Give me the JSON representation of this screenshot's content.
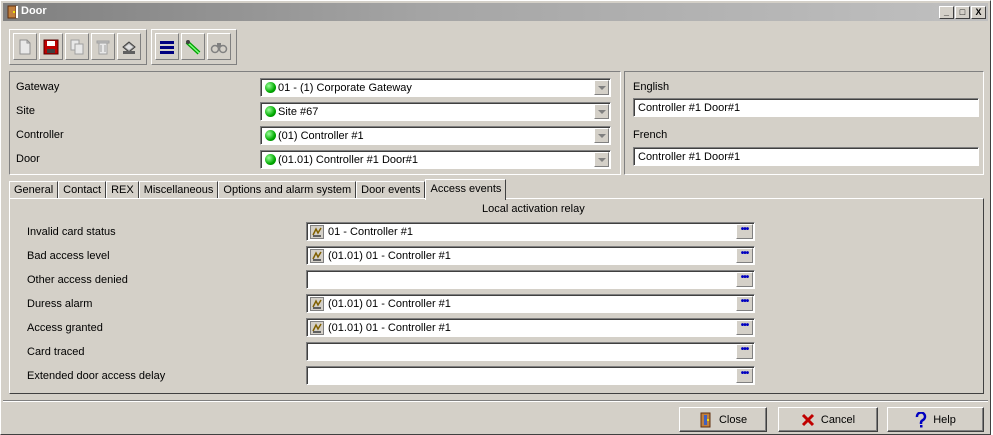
{
  "window": {
    "title": "Door"
  },
  "titlebar_buttons": {
    "minimize": "_",
    "maximize": "□",
    "close": "X"
  },
  "toolbar": {
    "icons": [
      "new-icon",
      "save-icon",
      "copy-icon",
      "delete-icon",
      "print-icon",
      "list-icon",
      "link-icon",
      "find-icon"
    ]
  },
  "door_form": {
    "gateway_label": "Gateway",
    "gateway_value": "01 - (1)  Corporate Gateway",
    "site_label": "Site",
    "site_value": "Site #67",
    "controller_label": "Controller",
    "controller_value": "(01) Controller #1",
    "door_label": "Door",
    "door_value": "(01.01) Controller #1 Door#1"
  },
  "names": {
    "english_label": "English",
    "english_value": "Controller #1 Door#1",
    "french_label": "French",
    "french_value": "Controller #1 Door#1"
  },
  "tabs": [
    {
      "label": "General"
    },
    {
      "label": "Contact"
    },
    {
      "label": "REX"
    },
    {
      "label": "Miscellaneous"
    },
    {
      "label": "Options and alarm system"
    },
    {
      "label": "Door events"
    },
    {
      "label": "Access events",
      "active": true
    }
  ],
  "access_events": {
    "column_header": "Local activation relay",
    "rows": [
      {
        "label": "Invalid card status",
        "value": "01 - Controller #1",
        "has_icon": true
      },
      {
        "label": "Bad access level",
        "value": "(01.01) 01 - Controller #1",
        "has_icon": true
      },
      {
        "label": "Other access denied",
        "value": "",
        "has_icon": false
      },
      {
        "label": "Duress alarm",
        "value": "(01.01) 01 - Controller #1",
        "has_icon": true
      },
      {
        "label": "Access granted",
        "value": "(01.01) 01 - Controller #1",
        "has_icon": true
      },
      {
        "label": "Card traced",
        "value": "",
        "has_icon": false
      },
      {
        "label": "Extended door access delay",
        "value": "",
        "has_icon": false
      }
    ],
    "browse_label": "•••"
  },
  "buttons": {
    "close_label": "Close",
    "cancel_label": "Cancel",
    "help_label": "Help"
  },
  "colors": {
    "status_green": "#00a000",
    "help_blue": "#0000c0",
    "cancel_red": "#c00000"
  }
}
